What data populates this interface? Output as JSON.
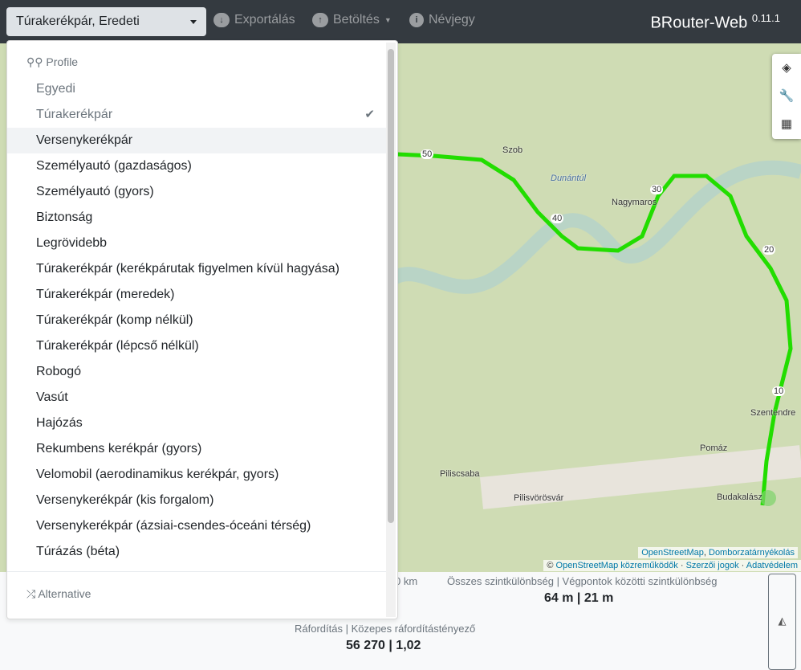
{
  "nav": {
    "profile_selected": "Túrakerékpár, Eredeti",
    "export": "Exportálás",
    "load": "Betöltés",
    "about": "Névjegy",
    "brand": "BRouter-Web",
    "version": "0.11.1"
  },
  "dropdown": {
    "profile_header": "Profile",
    "alternative_header": "Alternative",
    "items": [
      {
        "label": "Egyedi",
        "state": "disabled"
      },
      {
        "label": "Túrakerékpár",
        "state": "selected"
      },
      {
        "label": "Versenykerékpár",
        "state": "hover"
      },
      {
        "label": "Személyautó (gazdaságos)"
      },
      {
        "label": "Személyautó (gyors)"
      },
      {
        "label": "Biztonság"
      },
      {
        "label": "Legrövidebb"
      },
      {
        "label": "Túrakerékpár (kerékpárutak figyelmen kívül hagyása)"
      },
      {
        "label": "Túrakerékpár (meredek)"
      },
      {
        "label": "Túrakerékpár (komp nélkül)"
      },
      {
        "label": "Túrakerékpár (lépcső nélkül)"
      },
      {
        "label": "Robogó"
      },
      {
        "label": "Vasút"
      },
      {
        "label": "Hajózás"
      },
      {
        "label": "Rekumbens kerékpár (gyors)"
      },
      {
        "label": "Velomobil (aerodinamikus kerékpár, gyors)"
      },
      {
        "label": "Versenykerékpár (kis forgalom)"
      },
      {
        "label": "Versenykerékpár (ázsiai-csendes-óceáni térség)"
      },
      {
        "label": "Túrázás (béta)"
      }
    ]
  },
  "map": {
    "places": [
      "Szob",
      "Nagymaros",
      "Szentendre",
      "Pomáz",
      "Piliscsaba",
      "Pilisvörösvár",
      "Budakalász",
      "Dunántúl"
    ],
    "km_markers": [
      "50",
      "40",
      "30",
      "20",
      "10"
    ],
    "attribution_layers": [
      "OpenStreetMap",
      "Domborzatárnyékolás"
    ],
    "attribution": {
      "copy": "©",
      "osm": "OpenStreetMap közreműködők",
      "copyright": "Szerzői jogok",
      "privacy": "Adatvédelem"
    },
    "route_color": "#22dd00"
  },
  "stats": {
    "distance_partial": "0 km",
    "elevation_label": "Összes szintkülönbség | Végpontok közötti szintkülönbség",
    "elevation_value": "64 m | 21 m",
    "cost_label": "Ráfordítás | Közepes ráfordítástényező",
    "cost_value": "56 270 | 1,02"
  }
}
